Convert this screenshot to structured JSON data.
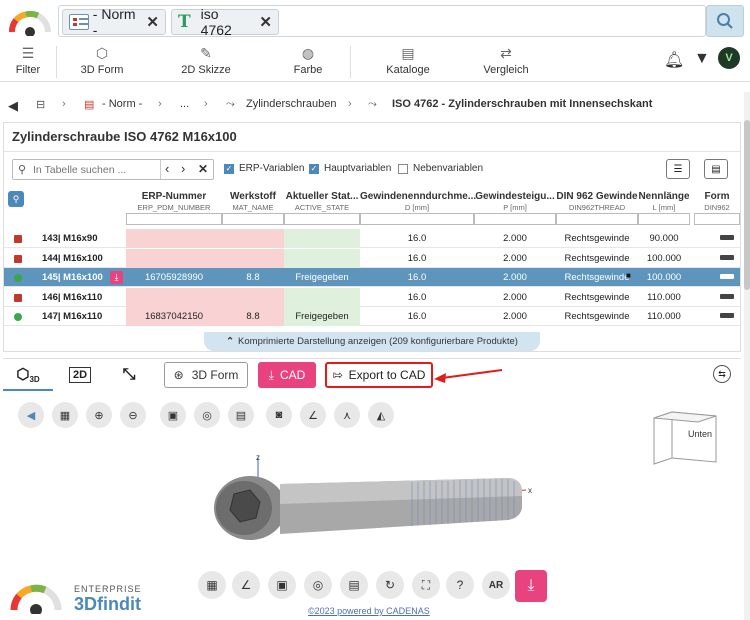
{
  "search": {
    "chips": [
      {
        "label": "- Norm -"
      },
      {
        "label": "iso 4762"
      }
    ]
  },
  "toolbar": {
    "items": [
      {
        "label": "Filter"
      },
      {
        "label": "3D Form"
      },
      {
        "label": "2D Skizze"
      },
      {
        "label": "Farbe"
      },
      {
        "label": "Kataloge"
      },
      {
        "label": "Vergleich"
      }
    ]
  },
  "breadcrumb": {
    "items": [
      "- Norm -",
      "...",
      "Zylinderschrauben",
      "ISO 4762 - Zylinderschrauben mit Innensechskant"
    ]
  },
  "panel": {
    "title": "Zylinderschraube ISO 4762 M16x100",
    "table_search_placeholder": "In Tabelle suchen ...",
    "options": [
      {
        "label": "ERP-Variablen",
        "checked": true
      },
      {
        "label": "Hauptvariablen",
        "checked": true
      },
      {
        "label": "Nebenvariablen",
        "checked": false
      }
    ],
    "columns": [
      {
        "title": "ERP-Nummer",
        "sub": "ERP_PDM_NUMBER"
      },
      {
        "title": "Werkstoff",
        "sub": "MAT_NAME"
      },
      {
        "title": "Aktueller Stat...",
        "sub": "ACTIVE_STATE"
      },
      {
        "title": "Gewindenenndurchme...",
        "sub": "D [mm]"
      },
      {
        "title": "Gewindesteigu...",
        "sub": "P [mm]"
      },
      {
        "title": "DIN 962 Gewinde",
        "sub": "DIN962THREAD"
      },
      {
        "title": "Nennlänge",
        "sub": "L [mm]"
      },
      {
        "title": "Form",
        "sub": "DIN962"
      }
    ],
    "rows": [
      {
        "name": "143| M16x90",
        "erp": "",
        "mat": "",
        "state": "",
        "d": "16.0",
        "p": "2.000",
        "thread": "Rechtsgewinde",
        "l": "90.000"
      },
      {
        "name": "144| M16x100",
        "erp": "",
        "mat": "",
        "state": "",
        "d": "16.0",
        "p": "2.000",
        "thread": "Rechtsgewinde",
        "l": "100.000"
      },
      {
        "name": "145| M16x100",
        "erp": "16705928990",
        "mat": "8.8",
        "state": "Freigegeben",
        "d": "16.0",
        "p": "2.000",
        "thread": "Rechtsgewinde",
        "l": "100.000"
      },
      {
        "name": "146| M16x110",
        "erp": "",
        "mat": "",
        "state": "",
        "d": "16.0",
        "p": "2.000",
        "thread": "Rechtsgewinde",
        "l": "110.000"
      },
      {
        "name": "147| M16x110",
        "erp": "16837042150",
        "mat": "8.8",
        "state": "Freigegeben",
        "d": "16.0",
        "p": "2.000",
        "thread": "Rechtsgewinde",
        "l": "110.000"
      }
    ],
    "selected_row": 2,
    "compact_label": "Komprimierte Darstellung anzeigen (209 konfigurierbare Produkte)"
  },
  "viewer": {
    "tabs": [
      {
        "label": "3D"
      },
      {
        "label": "2D"
      }
    ],
    "btn_3dform": "3D Form",
    "btn_cad": "CAD",
    "btn_export": "Export to CAD",
    "cube_label": "Unten",
    "axis_z": "z",
    "axis_x": "x",
    "brand_top": "ENTERPRISE",
    "brand_main": "3Dfindit",
    "ar_label": "AR",
    "copyright": "©2023 powered by CADENAS"
  },
  "colors": {
    "accent_blue": "#5d95bd",
    "pink": "#e8427f",
    "red_annotation": "#e21b1b"
  }
}
